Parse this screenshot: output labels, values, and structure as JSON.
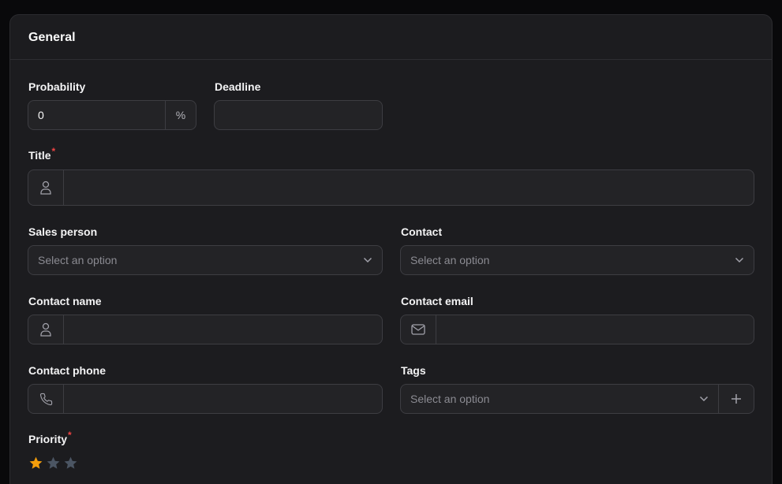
{
  "section": {
    "title": "General"
  },
  "fields": {
    "probability": {
      "label": "Probability",
      "value": "0",
      "suffix": "%"
    },
    "deadline": {
      "label": "Deadline",
      "value": ""
    },
    "title": {
      "label": "Title",
      "required_mark": "*",
      "value": ""
    },
    "sales_person": {
      "label": "Sales person",
      "placeholder": "Select an option"
    },
    "contact": {
      "label": "Contact",
      "placeholder": "Select an option"
    },
    "contact_name": {
      "label": "Contact name",
      "value": ""
    },
    "contact_email": {
      "label": "Contact email",
      "value": ""
    },
    "contact_phone": {
      "label": "Contact phone",
      "value": ""
    },
    "tags": {
      "label": "Tags",
      "placeholder": "Select an option"
    },
    "priority": {
      "label": "Priority",
      "required_mark": "*",
      "rating": 1,
      "max": 3
    }
  },
  "colors": {
    "star_active": "#f59e0b",
    "star_inactive": "#4b5563",
    "required": "#ef4444",
    "icon": "#a1a1aa"
  },
  "icons": {
    "user": "user-icon",
    "mail": "mail-icon",
    "phone": "phone-icon",
    "chevron": "chevron-down-icon",
    "plus": "plus-icon",
    "star": "star-icon"
  }
}
